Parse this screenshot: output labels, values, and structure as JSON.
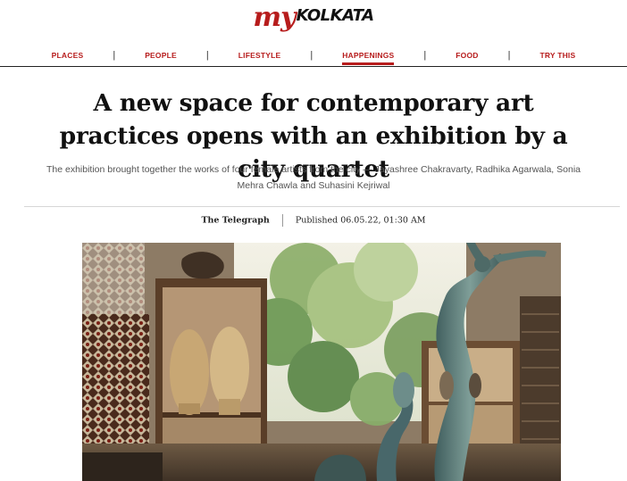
{
  "brand": {
    "logo_my": "my",
    "logo_kolkata": "KOLKATA"
  },
  "nav": {
    "items": [
      {
        "label": "PLACES",
        "active": false
      },
      {
        "label": "PEOPLE",
        "active": false
      },
      {
        "label": "LIFESTYLE",
        "active": false
      },
      {
        "label": "HAPPENINGS",
        "active": true
      },
      {
        "label": "FOOD",
        "active": false
      },
      {
        "label": "TRY THIS",
        "active": false
      }
    ],
    "separator": "|"
  },
  "article": {
    "headline": "A new space for contemporary art practices opens with an exhibition by a city quartet",
    "standfirst": "The exhibition brought together the works of four female artists from the city —  Jayashree Chakravarty, Radhika Agarwala, Sonia Mehra Chawla and Suhasini Kejriwal",
    "source": "The Telegraph",
    "published": "Published 06.05.22, 01:30 AM"
  },
  "colors": {
    "accent": "#b71c1c",
    "rule": "#d6d6d6",
    "muted_text": "#555555"
  }
}
